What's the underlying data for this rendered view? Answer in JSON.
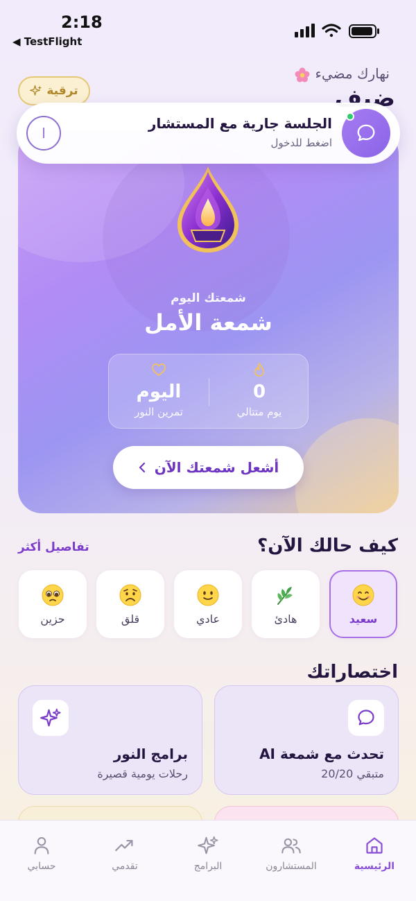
{
  "status_bar": {
    "time": "2:18",
    "back_label": "◀ TestFlight"
  },
  "header": {
    "greeting": "نهارك مضيء",
    "user_name": "ضيف",
    "upgrade_label": "ترقية"
  },
  "session_banner": {
    "title": "الجلسة جارية مع المستشار",
    "subtitle": "اضغط للدخول",
    "end_label": "ا"
  },
  "hero": {
    "subtitle": "شمعتك اليوم",
    "title": "شمعة الأمل",
    "stats": [
      {
        "value": "0",
        "label": "يوم متتالي",
        "icon": "flame-icon"
      },
      {
        "value": "اليوم",
        "label": "تمرين النور",
        "icon": "heart-icon"
      }
    ],
    "cta_label": "أشعل شمعتك الآن"
  },
  "mood": {
    "title": "كيف حالك الآن؟",
    "more_label": "تفاصيل أكثر",
    "options": [
      {
        "label": "سعيد",
        "icon": "smiling-face-icon",
        "selected": true
      },
      {
        "label": "هادئ",
        "icon": "leaf-icon",
        "selected": false
      },
      {
        "label": "عادي",
        "icon": "neutral-face-icon",
        "selected": false
      },
      {
        "label": "قلق",
        "icon": "worried-face-icon",
        "selected": false
      },
      {
        "label": "حزين",
        "icon": "sad-face-icon",
        "selected": false
      }
    ]
  },
  "shortcuts": {
    "title": "اختصاراتك",
    "items": [
      {
        "title": "تحدث مع شمعة AI",
        "subtitle": "متبقي 20/20",
        "icon": "chat-bubble-icon"
      },
      {
        "title": "برامج النور",
        "subtitle": "رحلات يومية قصيرة",
        "icon": "sparkles-icon"
      }
    ]
  },
  "tabbar": {
    "items": [
      {
        "label": "الرئيسية",
        "icon": "home-icon",
        "active": true
      },
      {
        "label": "المستشارون",
        "icon": "users-icon",
        "active": false
      },
      {
        "label": "البرامج",
        "icon": "sparkles-icon",
        "active": false
      },
      {
        "label": "تقدمي",
        "icon": "trending-up-icon",
        "active": false
      },
      {
        "label": "حسابي",
        "icon": "user-icon",
        "active": false
      }
    ]
  },
  "colors": {
    "accent": "#8a4fd6",
    "gold": "#e4c877",
    "online": "#2ecc71"
  }
}
